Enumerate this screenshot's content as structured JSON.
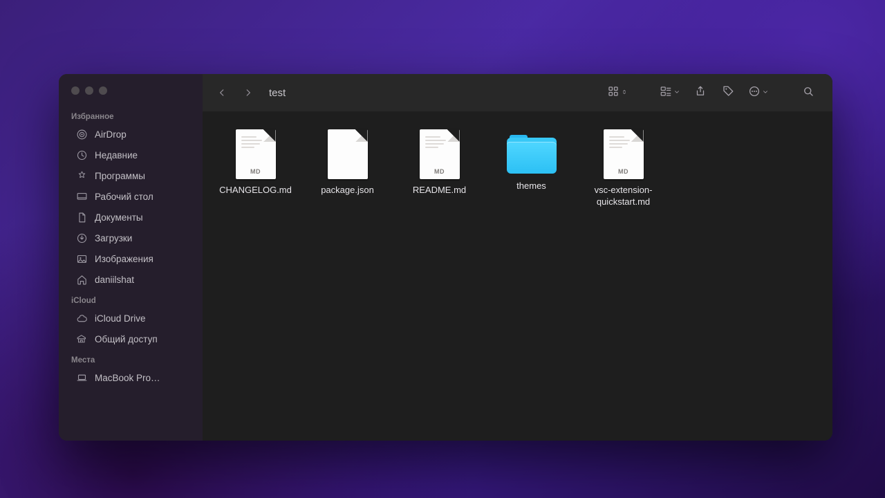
{
  "window": {
    "title": "test"
  },
  "sidebar": {
    "sections": [
      {
        "heading": "Избранное",
        "items": [
          {
            "icon": "airdrop-icon",
            "label": "AirDrop"
          },
          {
            "icon": "recents-icon",
            "label": "Недавние"
          },
          {
            "icon": "apps-icon",
            "label": "Программы"
          },
          {
            "icon": "desktop-icon",
            "label": "Рабочий стол"
          },
          {
            "icon": "documents-icon",
            "label": "Документы"
          },
          {
            "icon": "downloads-icon",
            "label": "Загрузки"
          },
          {
            "icon": "pictures-icon",
            "label": "Изображения"
          },
          {
            "icon": "home-icon",
            "label": "daniilshat"
          }
        ]
      },
      {
        "heading": "iCloud",
        "items": [
          {
            "icon": "icloud-icon",
            "label": "iCloud Drive"
          },
          {
            "icon": "shared-icon",
            "label": "Общий доступ"
          }
        ]
      },
      {
        "heading": "Места",
        "items": [
          {
            "icon": "laptop-icon",
            "label": "MacBook Pro…"
          }
        ]
      }
    ]
  },
  "files": [
    {
      "name": "CHANGELOG.md",
      "type": "md",
      "tag": "MD"
    },
    {
      "name": "package.json",
      "type": "plain",
      "tag": ""
    },
    {
      "name": "README.md",
      "type": "md",
      "tag": "MD"
    },
    {
      "name": "themes",
      "type": "folder",
      "tag": ""
    },
    {
      "name": "vsc-extension-quickstart.md",
      "type": "md",
      "tag": "MD"
    }
  ]
}
